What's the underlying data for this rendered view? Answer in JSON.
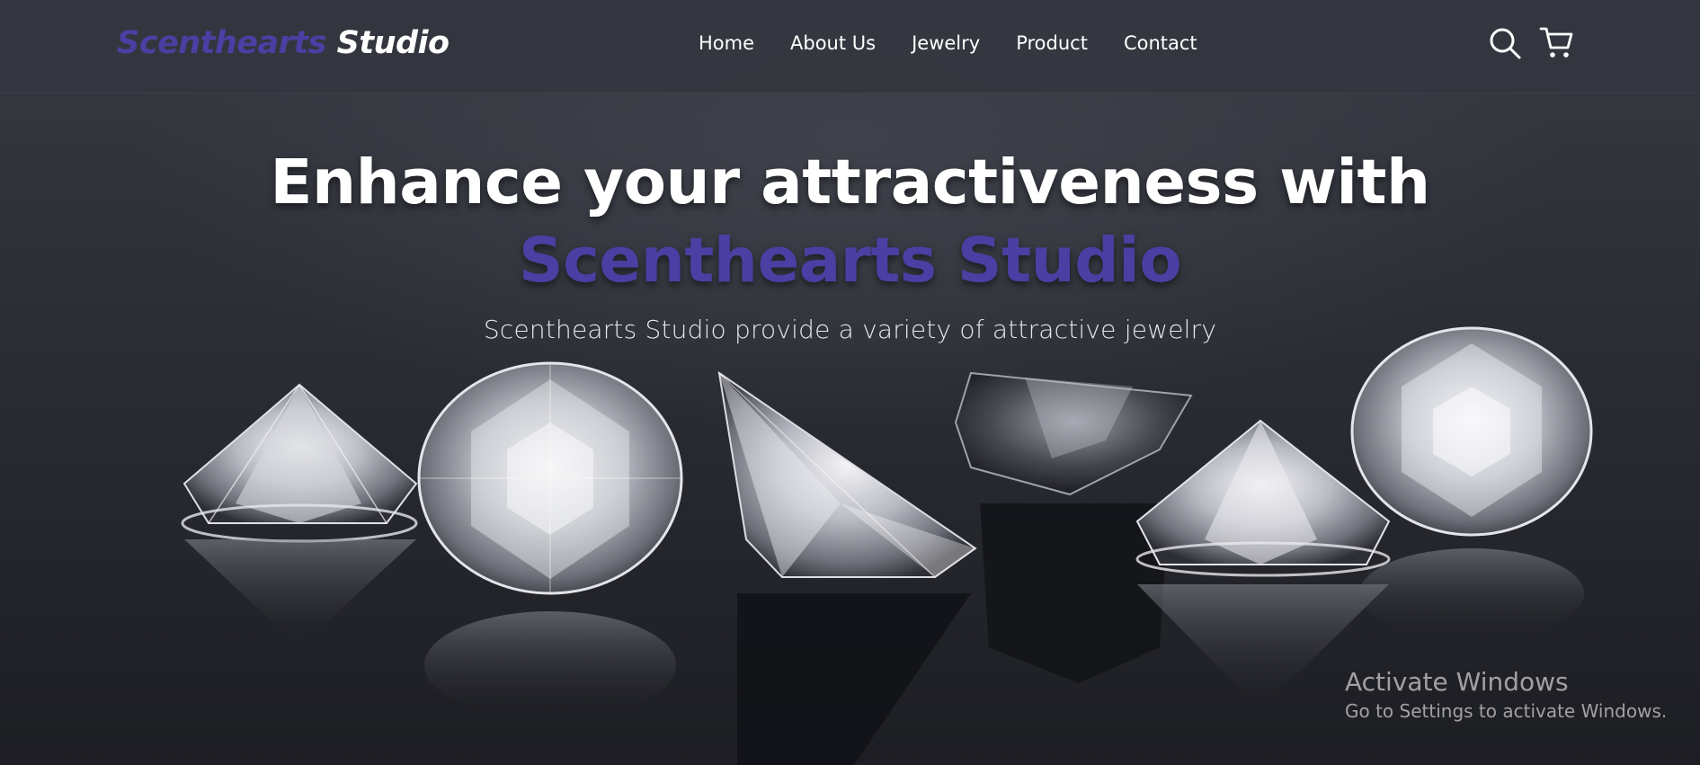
{
  "header": {
    "logo_brand": "Scenthearts",
    "logo_rest": "Studio",
    "nav": [
      {
        "label": "Home"
      },
      {
        "label": "About Us"
      },
      {
        "label": "Jewelry"
      },
      {
        "label": "Product"
      },
      {
        "label": "Contact"
      }
    ],
    "icons": [
      "search-icon",
      "cart-icon"
    ]
  },
  "hero": {
    "title_line1": "Enhance your attractiveness with",
    "title_line2": "Scenthearts Studio",
    "subtitle": "Scenthearts Studio provide a variety of attractive jewelry"
  },
  "watermark": {
    "title": "Activate Windows",
    "subtitle": "Go to Settings to activate Windows."
  },
  "colors": {
    "accent": "#4b3fa3",
    "navbar": "#34363f",
    "text": "#ffffff"
  }
}
